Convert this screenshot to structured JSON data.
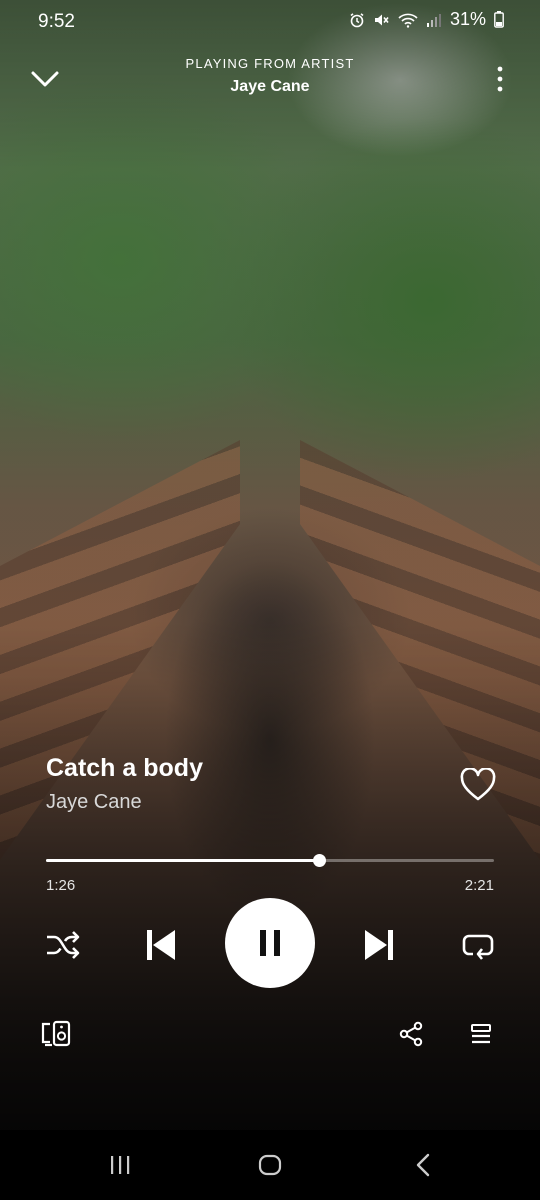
{
  "status_bar": {
    "time": "9:52",
    "battery": "31%",
    "icons": [
      "alarm-icon",
      "mute-icon",
      "wifi-icon",
      "signal-icon",
      "battery-icon"
    ]
  },
  "header": {
    "context_label": "PLAYING FROM ARTIST",
    "context_name": "Jaye Cane",
    "icons": [
      "chevron-down-icon",
      "more-vertical-icon"
    ]
  },
  "track": {
    "title": "Catch a body",
    "artist": "Jaye Cane",
    "liked": false
  },
  "playback": {
    "elapsed": "1:26",
    "total": "2:21",
    "progress_fraction": 0.61,
    "state": "playing"
  },
  "controls": {
    "icons": [
      "shuffle-icon",
      "skip-previous-icon",
      "pause-icon",
      "skip-next-icon",
      "repeat-icon",
      "devices-icon",
      "share-icon",
      "queue-icon"
    ]
  },
  "nav_bar": {
    "icons": [
      "recents-icon",
      "home-icon",
      "back-icon"
    ]
  },
  "colors": {
    "foreground": "#ffffff",
    "nav_background": "#000000"
  }
}
